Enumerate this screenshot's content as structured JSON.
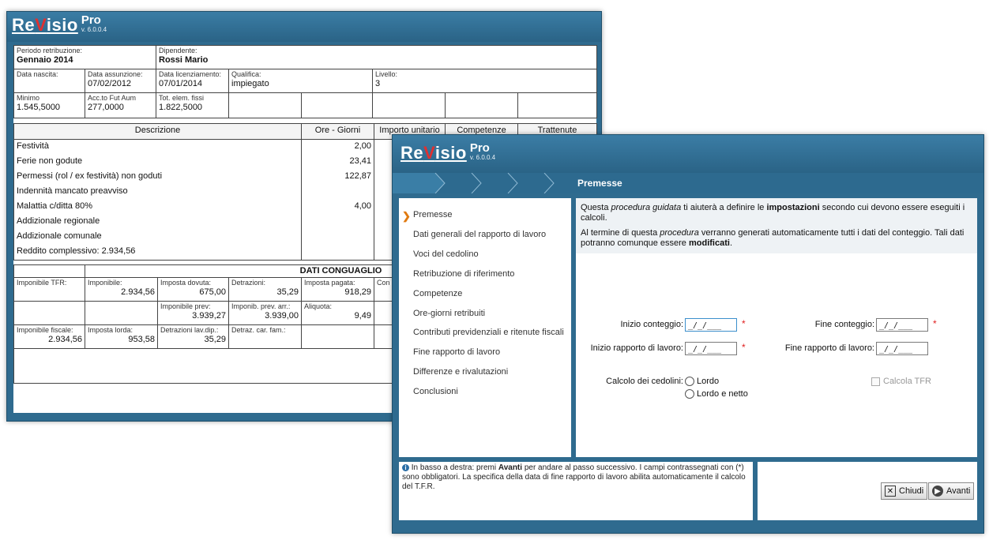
{
  "brand": {
    "name_pre": "Re",
    "name_v": "V",
    "name_post": "isio",
    "pro": "Pro",
    "version": "v. 6.0.0.4"
  },
  "colors": {
    "window": "#2f6b8f",
    "required": "#e02020",
    "arrow": "#e07a10"
  },
  "payslip": {
    "periodo_label": "Periodo retribuzione:",
    "periodo_value": "Gennaio 2014",
    "dipendente_label": "Dipendente:",
    "dipendente_value": "Rossi Mario",
    "nascita_label": "Data nascita:",
    "nascita_value": "",
    "assunzione_label": "Data assunzione:",
    "assunzione_value": "07/02/2012",
    "licenziamento_label": "Data licenziamento:",
    "licenziamento_value": "07/01/2014",
    "qualifica_label": "Qualifica:",
    "qualifica_value": "impiegato",
    "livello_label": "Livello:",
    "livello_value": "3",
    "minimo_label": "Minimo",
    "minimo_value": "1.545,5000",
    "acc_label": "Acc.to Fut Aum",
    "acc_value": "277,0000",
    "tot_label": "Tot. elem. fissi",
    "tot_value": "1.822,5000",
    "headers": {
      "descrizione": "Descrizione",
      "ore": "Ore - Giorni",
      "importo": "Importo unitario",
      "competenze": "Competenze",
      "trattenute": "Trattenute"
    },
    "rows": [
      {
        "desc": "Festività",
        "ore": "2,00"
      },
      {
        "desc": "Ferie non godute",
        "ore": "23,41"
      },
      {
        "desc": "Permessi (rol / ex festività) non goduti",
        "ore": "122,87"
      },
      {
        "desc": "Indennità mancato preavviso",
        "ore": ""
      },
      {
        "desc": "Malattia c/ditta 80%",
        "ore": "4,00"
      },
      {
        "desc": "Addizionale regionale",
        "ore": ""
      },
      {
        "desc": "Addizionale comunale",
        "ore": ""
      },
      {
        "desc": "Reddito complessivo: 2.934,56",
        "ore": ""
      }
    ],
    "conguaglio": {
      "title": "DATI CONGUAGLIO",
      "imponibile_tfr_label": "Imponibile TFR:",
      "imponibile_label": "Imponibile:",
      "imponibile_value": "2.934,56",
      "imposta_dovuta_label": "Imposta dovuta:",
      "imposta_dovuta_value": "675,00",
      "detrazioni_label": "Detrazioni:",
      "detrazioni_value": "35,29",
      "imposta_pagata_label": "Imposta pagata:",
      "imposta_pagata_value": "918,29",
      "con_label": "Con",
      "imponibile_prev_label": "Imponibile prev:",
      "imponibile_prev_value": "3.939,27",
      "imponib_arr_label": "Imponib. prev. arr.:",
      "imponib_arr_value": "3.939,00",
      "aliquota_label": "Aliquota:",
      "aliquota_value": "9,49",
      "imponibile_fiscale_label": "Imponibile fiscale:",
      "imponibile_fiscale_value": "2.934,56",
      "imposta_lorda_label": "Imposta lorda:",
      "imposta_lorda_value": "953,58",
      "detrazioni_lav_label": "Detrazioni lav.dip.:",
      "detrazioni_lav_value": "35,29",
      "detraz_car_label": "Detraz. car. fam.:"
    }
  },
  "wizard": {
    "step_title": "Premesse",
    "steps": [
      "Premesse",
      "Dati generali del rapporto di lavoro",
      "Voci del cedolino",
      "Retribuzione di riferimento",
      "Competenze",
      "Ore-giorni retribuiti",
      "Contributi previdenziali e ritenute fiscali",
      "Fine rapporto di lavoro",
      "Differenze e rivalutazioni",
      "Conclusioni"
    ],
    "intro1_a": "Questa ",
    "intro1_b": "procedura guidata",
    "intro1_c": " ti aiuterà a definire le ",
    "intro1_d": "impostazioni",
    "intro1_e": " secondo cui devono essere eseguiti i calcoli.",
    "intro2_a": "Al termine di questa ",
    "intro2_b": "procedura",
    "intro2_c": " verranno generati automaticamente tutti i dati del conteggio. Tali dati potranno comunque essere ",
    "intro2_d": "modificati",
    "intro2_e": ".",
    "fields": {
      "inizio_conteggio": "Inizio conteggio:",
      "fine_conteggio": "Fine conteggio:",
      "inizio_rapporto": "Inizio rapporto di lavoro:",
      "fine_rapporto": "Fine rapporto di lavoro:",
      "date_placeholder": "_/_/___",
      "required_mark": "*"
    },
    "calcolo_label": "Calcolo dei cedolini:",
    "radio_lordo": "Lordo",
    "radio_lordo_netto": "Lordo e netto",
    "calcola_tfr": "Calcola TFR",
    "info_a": " In basso a destra: premi ",
    "info_b": "Avanti",
    "info_c": " per andare al passo successivo. I campi contrassegnati con (*) sono obbligatori. La specifica della data di fine rapporto di lavoro abilita automaticamente il calcolo del T.F.R.",
    "btn_chiudi": "Chiudi",
    "btn_avanti": "Avanti"
  }
}
